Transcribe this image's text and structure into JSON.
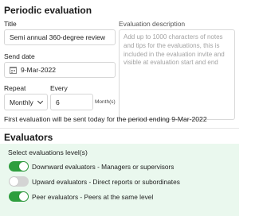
{
  "periodic": {
    "heading": "Periodic evaluation",
    "title_label": "Title",
    "title_value": "Semi annual 360-degree review",
    "desc_label": "Evaluation description",
    "desc_placeholder": "Add up to 1000 characters of notes and tips for the evaluations, this is included in the evaluation invite and visible at evaluation start and end",
    "send_date_label": "Send date",
    "send_date_value": "9-Mar-2022",
    "calendar_icon": "calendar-icon",
    "repeat_label": "Repeat",
    "repeat_value": "Monthly",
    "every_label": "Every",
    "every_value": "6",
    "every_unit": "Month(s)",
    "info_text": "First evaluation will be sent today for the period ending 9-Mar-2022"
  },
  "evaluators": {
    "heading": "Evaluators",
    "select_label": "Select evaluations level(s)",
    "items": [
      {
        "label": "Downward evaluators - Managers or supervisors",
        "enabled": true
      },
      {
        "label": "Upward evaluators - Direct reports or subordinates",
        "enabled": false
      },
      {
        "label": "Peer evaluators - Peers at the same level",
        "enabled": true
      }
    ]
  },
  "colors": {
    "toggle_on": "#2e9e3e",
    "toggle_off": "#d4d4d4",
    "panel_bg": "#eaf8ee"
  }
}
